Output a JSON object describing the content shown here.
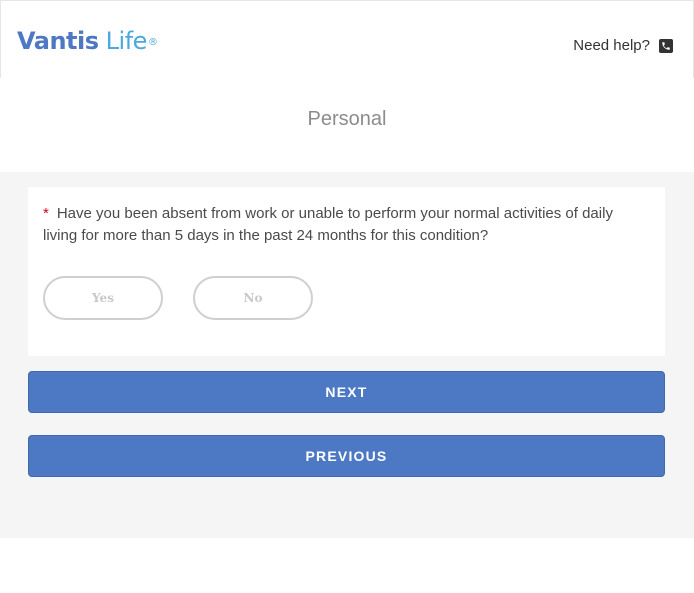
{
  "header": {
    "logo": {
      "word1": "Vantis",
      "word2": "Life",
      "mark": "®"
    },
    "help_label": "Need help?",
    "help_icon": "phone-icon"
  },
  "section": {
    "title": "Personal"
  },
  "question": {
    "required_marker": "*",
    "text": "Have you been absent from work or unable to perform your normal activities of daily living for more than 5 days in the past 24 months for this condition?",
    "options": [
      "Yes",
      "No"
    ],
    "selected": null
  },
  "buttons": {
    "next": "NEXT",
    "previous": "PREVIOUS"
  },
  "colors": {
    "brand_blue": "#4e78c4",
    "brand_light_blue": "#4aa8e0",
    "button": "#4d79c4",
    "required": "#d0021b",
    "band": "#f5f5f5"
  }
}
